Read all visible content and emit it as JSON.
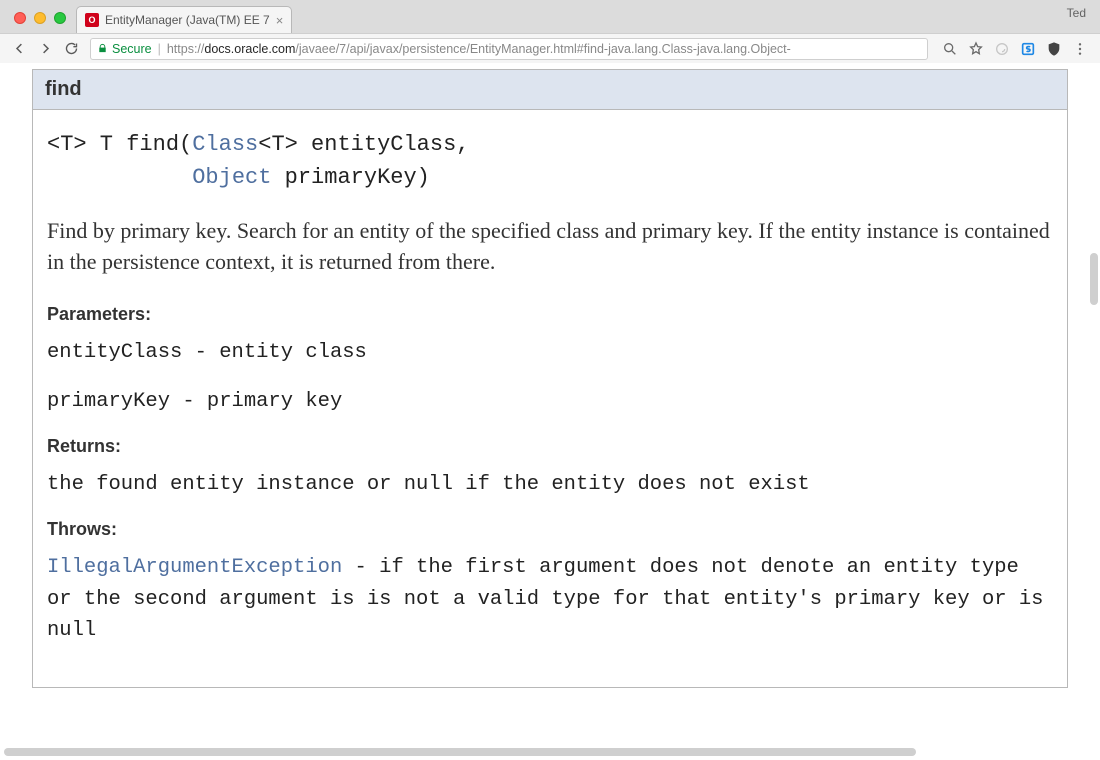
{
  "browser": {
    "profile_name": "Ted",
    "tab": {
      "title": "EntityManager (Java(TM) EE 7",
      "favicon_letter": "O"
    },
    "secure_label": "Secure",
    "url_scheme": "https://",
    "url_host": "docs.oracle.com",
    "url_path": "/javaee/7/api/javax/persistence/EntityManager.html#find-java.lang.Class-java.lang.Object-"
  },
  "doc": {
    "method_name": "find",
    "signature": {
      "line1_pre": "<T> T find(",
      "line1_class": "Class",
      "line1_post_class": "<T> entityClass,",
      "line2_indent": "           ",
      "line2_object": "Object",
      "line2_post": " primaryKey)"
    },
    "description": "Find by primary key. Search for an entity of the specified class and primary key. If the entity instance is contained in the persistence context, it is returned from there.",
    "labels": {
      "parameters": "Parameters:",
      "returns": "Returns:",
      "throws": "Throws:"
    },
    "parameters": {
      "p1": "entityClass - entity class",
      "p2": "primaryKey - primary key"
    },
    "returns_text": "the found entity instance or null if the entity does not exist",
    "throws": {
      "exception": "IllegalArgumentException",
      "rest": " - if the first argument does not denote an entity type or the second argument is is not a valid type for that entity's primary key or is null"
    }
  }
}
